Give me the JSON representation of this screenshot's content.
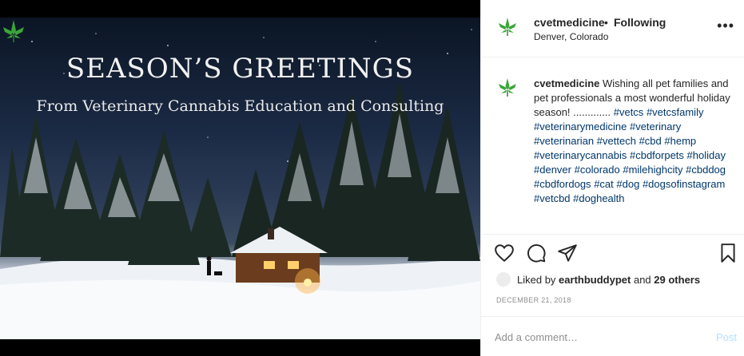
{
  "image": {
    "title": "SEASON’S GREETINGS",
    "subtitle": "From Veterinary Cannabis Education and Consulting"
  },
  "header": {
    "username": "cvetmedicine",
    "separator": "•",
    "follow_status": "Following",
    "location": "Denver, Colorado",
    "more_icon": "more-options-icon"
  },
  "caption": {
    "username": "cvetmedicine",
    "text": "Wishing all pet families and pet professionals a most wonderful holiday season! .............",
    "hashtags": [
      "#vetcs",
      "#vetcsfamily",
      "#veterinarymedicine",
      "#veterinary",
      "#veterinarian",
      "#vettech",
      "#cbd",
      "#hemp",
      "#veterinarycannabis",
      "#cbdforpets",
      "#holiday",
      "#denver",
      "#colorado",
      "#milehighcity",
      "#cbddog",
      "#cbdfordogs",
      "#cat",
      "#dog",
      "#dogsofinstagram",
      "#vetcbd",
      "#doghealth"
    ]
  },
  "actions": {
    "like_icon": "heart-icon",
    "comment_icon": "comment-icon",
    "share_icon": "share-icon",
    "save_icon": "bookmark-icon"
  },
  "likes": {
    "prefix": "Liked by",
    "user": "earthbuddypet",
    "conj": "and",
    "others": "29 others"
  },
  "date": "DECEMBER 21, 2018",
  "comment": {
    "placeholder": "Add a comment…",
    "post_label": "Post"
  },
  "colors": {
    "brand_leaf": "#3aa63a",
    "link": "#00376b",
    "post_disabled": "#b2dffc"
  }
}
